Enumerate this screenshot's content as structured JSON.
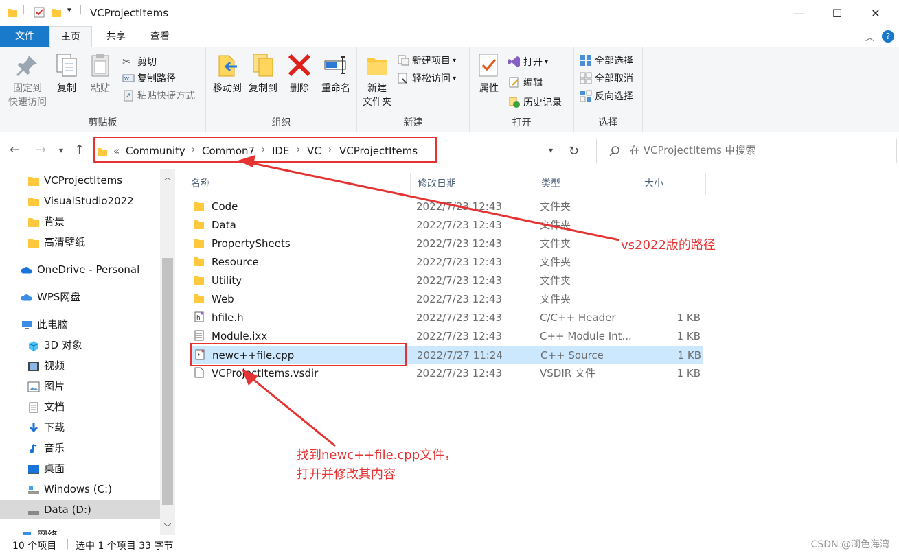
{
  "window": {
    "title": "VCProjectItems",
    "minimize": "—",
    "maximize": "☐",
    "close": "✕"
  },
  "ribbon": {
    "tabs": {
      "file": "文件",
      "home": "主页",
      "share": "共享",
      "view": "查看"
    },
    "clipboard": {
      "label": "剪贴板",
      "pin_line1": "固定到",
      "pin_line2": "快速访问",
      "copy": "复制",
      "paste": "粘贴",
      "cut": "剪切",
      "copy_path": "复制路径",
      "paste_shortcut": "粘贴快捷方式"
    },
    "organize": {
      "label": "组织",
      "move_to": "移动到",
      "copy_to": "复制到",
      "delete": "删除",
      "rename": "重命名"
    },
    "new": {
      "label": "新建",
      "new_folder_line1": "新建",
      "new_folder_line2": "文件夹",
      "new_item": "新建项目",
      "easy_access": "轻松访问"
    },
    "open": {
      "label": "打开",
      "properties": "属性",
      "open": "打开",
      "edit": "编辑",
      "history": "历史记录"
    },
    "select": {
      "label": "选择",
      "select_all": "全部选择",
      "select_none": "全部取消",
      "invert": "反向选择"
    }
  },
  "address": {
    "overflow": "«",
    "crumbs": [
      "Community",
      "Common7",
      "IDE",
      "VC",
      "VCProjectItems"
    ],
    "search_placeholder": "在 VCProjectItems 中搜索"
  },
  "navpane": {
    "items": [
      {
        "label": "VCProjectItems",
        "icon": "folder-icon"
      },
      {
        "label": "VisualStudio2022",
        "icon": "folder-icon"
      },
      {
        "label": "背景",
        "icon": "folder-icon"
      },
      {
        "label": "高清壁纸",
        "icon": "folder-icon"
      },
      {
        "label": "OneDrive - Personal",
        "icon": "cloud-icon"
      },
      {
        "label": "WPS网盘",
        "icon": "cloud-icon"
      },
      {
        "label": "此电脑",
        "icon": "computer-icon"
      },
      {
        "label": "3D 对象",
        "icon": "cube-icon"
      },
      {
        "label": "视频",
        "icon": "video-icon"
      },
      {
        "label": "图片",
        "icon": "picture-icon"
      },
      {
        "label": "文档",
        "icon": "document-icon"
      },
      {
        "label": "下载",
        "icon": "download-icon"
      },
      {
        "label": "音乐",
        "icon": "music-icon"
      },
      {
        "label": "桌面",
        "icon": "desktop-icon"
      },
      {
        "label": "Windows (C:)",
        "icon": "drive-icon"
      },
      {
        "label": "Data (D:)",
        "icon": "drive-icon"
      },
      {
        "label": "网络",
        "icon": "network-icon"
      }
    ]
  },
  "filelist": {
    "columns": {
      "name": "名称",
      "date": "修改日期",
      "type": "类型",
      "size": "大小"
    },
    "rows": [
      {
        "name": "Code",
        "date": "2022/7/23 12:43",
        "type": "文件夹",
        "size": "",
        "icon": "folder-icon"
      },
      {
        "name": "Data",
        "date": "2022/7/23 12:43",
        "type": "文件夹",
        "size": "",
        "icon": "folder-icon"
      },
      {
        "name": "PropertySheets",
        "date": "2022/7/23 12:43",
        "type": "文件夹",
        "size": "",
        "icon": "folder-icon"
      },
      {
        "name": "Resource",
        "date": "2022/7/23 12:43",
        "type": "文件夹",
        "size": "",
        "icon": "folder-icon"
      },
      {
        "name": "Utility",
        "date": "2022/7/23 12:43",
        "type": "文件夹",
        "size": "",
        "icon": "folder-icon"
      },
      {
        "name": "Web",
        "date": "2022/7/23 12:43",
        "type": "文件夹",
        "size": "",
        "icon": "folder-icon"
      },
      {
        "name": "hfile.h",
        "date": "2022/7/23 12:43",
        "type": "C/C++ Header",
        "size": "1 KB",
        "icon": "header-file-icon"
      },
      {
        "name": "Module.ixx",
        "date": "2022/7/23 12:43",
        "type": "C++ Module Int...",
        "size": "1 KB",
        "icon": "text-file-icon"
      },
      {
        "name": "newc++file.cpp",
        "date": "2022/7/27 11:24",
        "type": "C++ Source",
        "size": "1 KB",
        "icon": "cpp-file-icon"
      },
      {
        "name": "VCProjectItems.vsdir",
        "date": "2022/7/23 12:43",
        "type": "VSDIR 文件",
        "size": "1 KB",
        "icon": "blank-file-icon"
      }
    ]
  },
  "status": {
    "count": "10 个项目",
    "selected": "选中 1 个项目  33 字节"
  },
  "annotations": {
    "path_note": "vs2022版的路径",
    "file_note_line1": "找到newc++file.cpp文件，",
    "file_note_line2": "打开并修改其内容"
  },
  "watermark": "CSDN @澜色海湾",
  "colors": {
    "accent": "#1979ca",
    "annotation": "#e53333",
    "selection": "#cce8ff",
    "folder": "#ffc83d"
  }
}
